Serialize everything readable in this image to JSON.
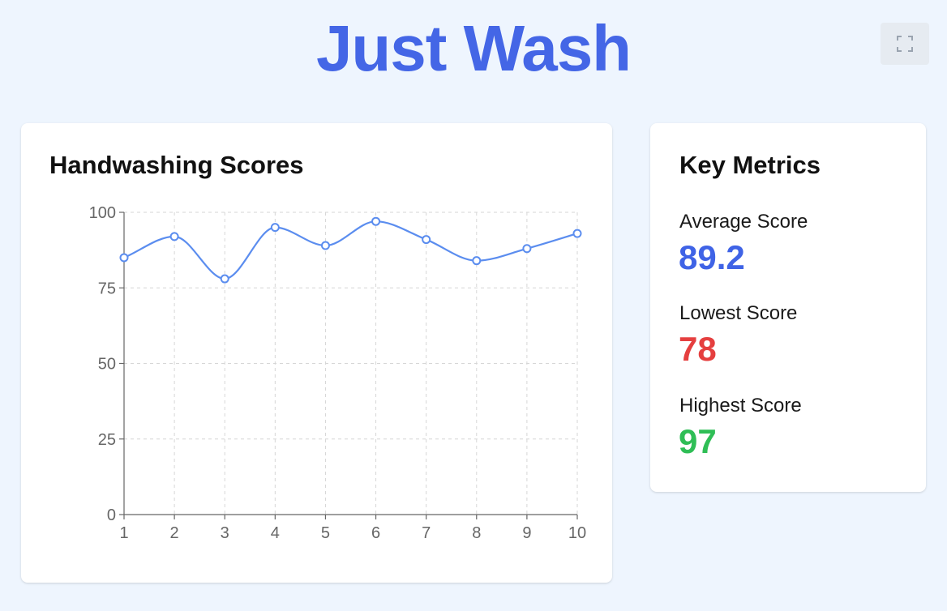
{
  "header": {
    "title": "Just Wash",
    "fullscreen_icon": "expand-icon"
  },
  "chart_card": {
    "title": "Handwashing Scores"
  },
  "chart_data": {
    "type": "line",
    "title": "Handwashing Scores",
    "xlabel": "",
    "ylabel": "",
    "x": [
      1,
      2,
      3,
      4,
      5,
      6,
      7,
      8,
      9,
      10
    ],
    "series": [
      {
        "values": [
          85,
          92,
          78,
          95,
          89,
          97,
          91,
          84,
          88,
          93
        ]
      }
    ],
    "xlim": [
      1,
      10
    ],
    "ylim": [
      0,
      100
    ],
    "yticks": [
      0,
      25,
      50,
      75,
      100
    ],
    "grid": true,
    "grid_style": "dashed",
    "curve": "smooth",
    "line_color": "#5b8def"
  },
  "metrics": {
    "title": "Key Metrics",
    "items": [
      {
        "label": "Average Score",
        "value": "89.2",
        "color": "#3f63e6"
      },
      {
        "label": "Lowest Score",
        "value": "78",
        "color": "#e53f3f"
      },
      {
        "label": "Highest Score",
        "value": "97",
        "color": "#2fbe56"
      }
    ]
  }
}
